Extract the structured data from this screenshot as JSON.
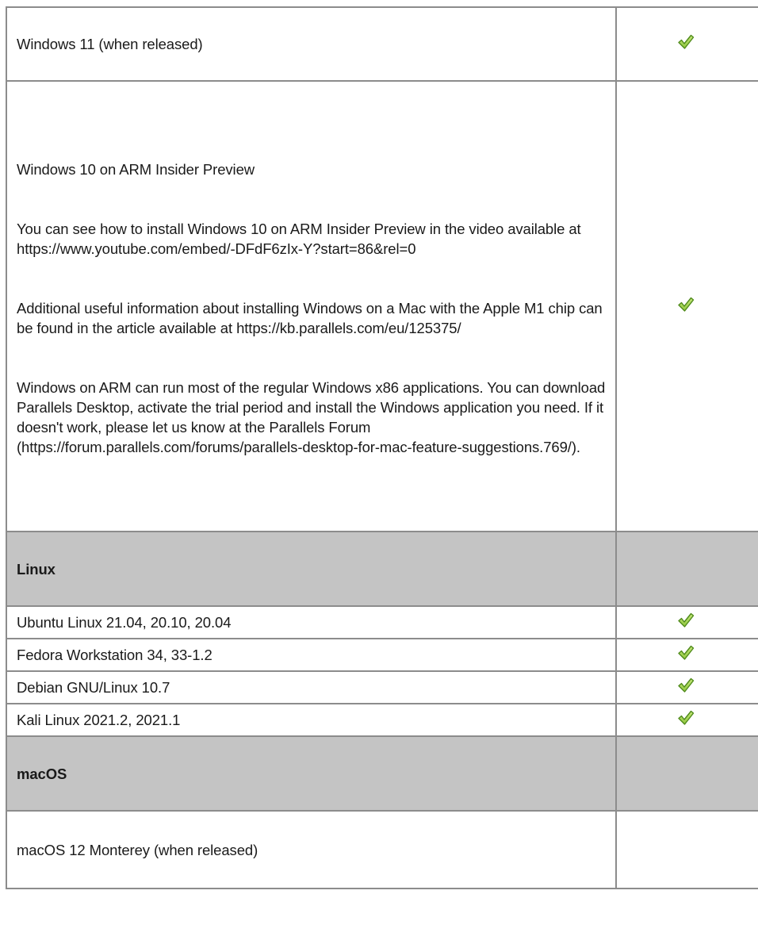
{
  "table": {
    "rows": [
      {
        "type": "item",
        "label": "Windows 11 (when released)",
        "supported": true,
        "height": 93
      },
      {
        "type": "item-multi",
        "paragraphs": [
          "Windows 10 on ARM Insider Preview",
          "You can see how to install Windows 10 on ARM Insider Preview in the video available at https://www.youtube.com/embed/-DFdF6zIx-Y?start=86&rel=0",
          "Additional useful information about installing Windows on a Mac with the Apple M1 chip can be found in the article available at https://kb.parallels.com/eu/125375/",
          "Windows on ARM can run most of the regular Windows x86 applications. You can download Parallels Desktop, activate the trial period and install the Windows application you need. If it doesn't work, please let us know at the Parallels Forum (https://forum.parallels.com/forums/parallels-desktop-for-mac-feature-suggestions.769/)."
        ],
        "supported": true
      },
      {
        "type": "section",
        "label": "Linux"
      },
      {
        "type": "item",
        "label": "Ubuntu Linux 21.04, 20.10, 20.04",
        "supported": true
      },
      {
        "type": "item",
        "label": "Fedora Workstation 34, 33-1.2",
        "supported": true
      },
      {
        "type": "item",
        "label": "Debian GNU/Linux 10.7",
        "supported": true
      },
      {
        "type": "item",
        "label": "Kali Linux 2021.2, 2021.1",
        "supported": true
      },
      {
        "type": "section",
        "label": "macOS"
      },
      {
        "type": "item",
        "label": "macOS 12 Monterey (when released)",
        "supported": false
      }
    ]
  },
  "icons": {
    "check": "check-icon"
  },
  "colors": {
    "border": "#8c8c8c",
    "section_bg": "#c4c4c4",
    "check_green": "#8fc63d",
    "check_dark": "#4f8a1b"
  }
}
